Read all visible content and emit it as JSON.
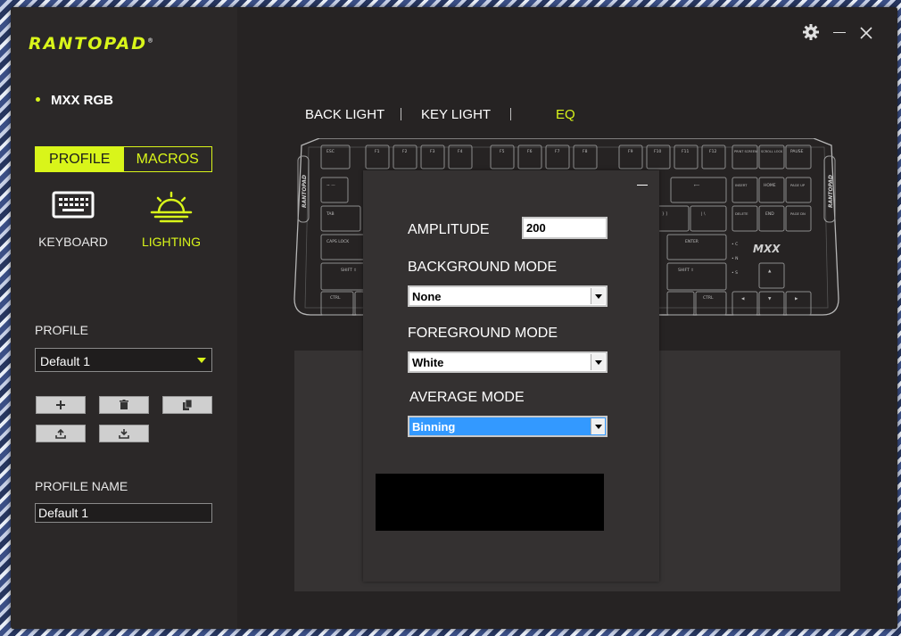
{
  "brand": {
    "logo": "RANTOPAD",
    "reg": "®"
  },
  "device": {
    "name": "MXX RGB"
  },
  "tabs": {
    "profile": "PROFILE",
    "macros": "MACROS"
  },
  "modes": {
    "keyboard": "KEYBOARD",
    "lighting": "LIGHTING"
  },
  "profile": {
    "section_label": "PROFILE",
    "selected": "Default 1",
    "name_label": "PROFILE NAME",
    "name_value": "Default 1"
  },
  "nav": {
    "back_light": "BACK LIGHT",
    "key_light": "KEY LIGHT",
    "eq": "EQ"
  },
  "eq_dialog": {
    "amplitude_label": "AMPLITUDE",
    "amplitude_value": "200",
    "background_mode_label": "BACKGROUND MODE",
    "background_mode_value": "None",
    "foreground_mode_label": "FOREGROUND MODE",
    "foreground_mode_value": "White",
    "average_mode_label": "AVERAGE MODE",
    "average_mode_value": "Binning"
  },
  "keyboard_image": {
    "brand_left": "RANTOPAD",
    "brand_right": "RANTOPAD",
    "model": "MXX",
    "keys": {
      "esc": "ESC",
      "f1": "F1",
      "f2": "F2",
      "f3": "F3",
      "f4": "F4",
      "f5": "F5",
      "f6": "F6",
      "f7": "F7",
      "f8": "F8",
      "f9": "F9",
      "f10": "F10",
      "f11": "F11",
      "f12": "F12",
      "prt": "PRINT SCREEN",
      "scr": "SCROLL LOCK",
      "pause": "PAUSE",
      "tab": "TAB",
      "caps": "CAPS LOCK",
      "lshift": "SHIFT ⇧",
      "rshift": "SHIFT ⇧",
      "lctrl": "CTRL",
      "rctrl": "CTRL",
      "enter": "ENTER",
      "insert": "INSERT",
      "home": "HOME",
      "pgup": "PAGE UP",
      "delete": "DELETE",
      "end": "END",
      "pgdn": "PAGE DN",
      "backspace": "⟵",
      "tilde": "~ —",
      "brackets": "} ]",
      "backslash": "| \\",
      "up": "▲",
      "left": "◀",
      "down": "▼",
      "right": "▶",
      "ind_c": "• C",
      "ind_n": "• N",
      "ind_s": "• S"
    }
  },
  "colors": {
    "accent": "#d9f51a",
    "background": "#292627",
    "selection": "#3399ff"
  },
  "icons": {
    "settings": "gear-icon",
    "minimize": "minimize-icon",
    "close": "close-icon",
    "keyboard": "keyboard-icon",
    "lighting": "sunrise-icon",
    "add": "plus-icon",
    "delete": "trash-icon",
    "copy": "copy-icon",
    "import": "upload-icon",
    "export": "download-icon"
  }
}
